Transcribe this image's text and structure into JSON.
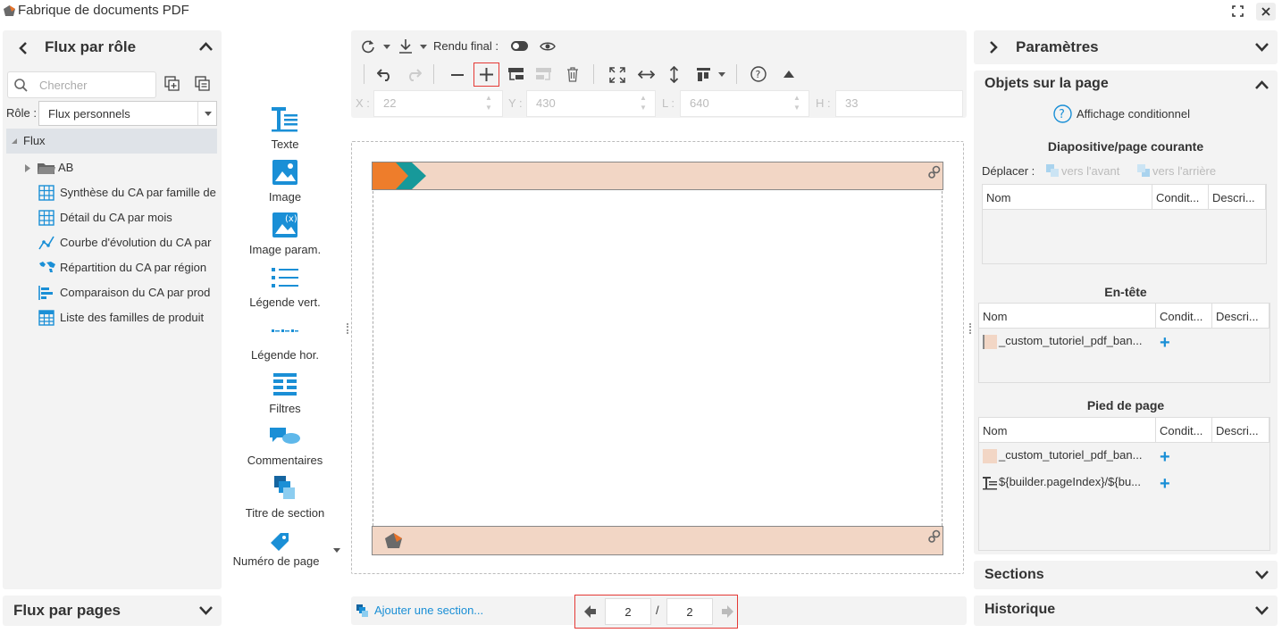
{
  "window": {
    "title": "Fabrique de documents PDF"
  },
  "left_panel": {
    "title": "Flux par rôle",
    "search_placeholder": "Chercher",
    "role_label": "Rôle :",
    "role_value": "Flux personnels",
    "tree": {
      "root": "Flux",
      "folder": "AB",
      "items": [
        {
          "label": "Synthèse du CA par famille de",
          "icon": "pivot-table-icon"
        },
        {
          "label": "Détail du CA par mois",
          "icon": "pivot-table-icon"
        },
        {
          "label": "Courbe d'évolution du CA par",
          "icon": "line-chart-icon"
        },
        {
          "label": "Répartition du CA par région",
          "icon": "map-icon"
        },
        {
          "label": "Comparaison du CA par prod",
          "icon": "bar-chart-icon"
        },
        {
          "label": "Liste des familles de produit",
          "icon": "table-icon"
        }
      ]
    }
  },
  "bottom_left_panel": {
    "title": "Flux par pages"
  },
  "palette": {
    "items": [
      {
        "label": "Texte"
      },
      {
        "label": "Image"
      },
      {
        "label": "Image param."
      },
      {
        "label": "Légende vert."
      },
      {
        "label": "Légende hor."
      },
      {
        "label": "Filtres"
      },
      {
        "label": "Commentaires"
      },
      {
        "label": "Titre de section"
      },
      {
        "label": "Numéro de page"
      }
    ]
  },
  "toolbar": {
    "rendu_final_label": "Rendu final :",
    "coords": {
      "x_label": "X :",
      "x_value": "22",
      "y_label": "Y :",
      "y_value": "430",
      "l_label": "L :",
      "l_value": "640",
      "h_label": "H :",
      "h_value": "33"
    }
  },
  "footer": {
    "add_section": "Ajouter une section...",
    "current_page": "2",
    "separator": "/",
    "total_pages": "2"
  },
  "right_panel": {
    "parametres_title": "Paramètres",
    "objets_title": "Objets sur la page",
    "conditional_display": "Affichage conditionnel",
    "current_slide_heading": "Diapositive/page courante",
    "move_label": "Déplacer :",
    "forward_label": "vers l'avant",
    "backward_label": "vers l'arrière",
    "columns": {
      "name": "Nom",
      "condition": "Condit...",
      "description": "Descri..."
    },
    "header_heading": "En-tête",
    "header_rows": [
      {
        "name": "_custom_tutoriel_pdf_ban..."
      }
    ],
    "footer_heading": "Pied de page",
    "footer_rows": [
      {
        "name": "_custom_tutoriel_pdf_ban...",
        "icon": "swatch"
      },
      {
        "name": "${builder.pageIndex}/${bu...",
        "icon": "text-icon"
      }
    ],
    "sections_title": "Sections",
    "historique_title": "Historique"
  },
  "colors": {
    "accent": "#1a8fd6",
    "banner": "#f2d6c5",
    "orange": "#ee7d2b",
    "teal": "#17999a",
    "highlight": "#e53935"
  }
}
